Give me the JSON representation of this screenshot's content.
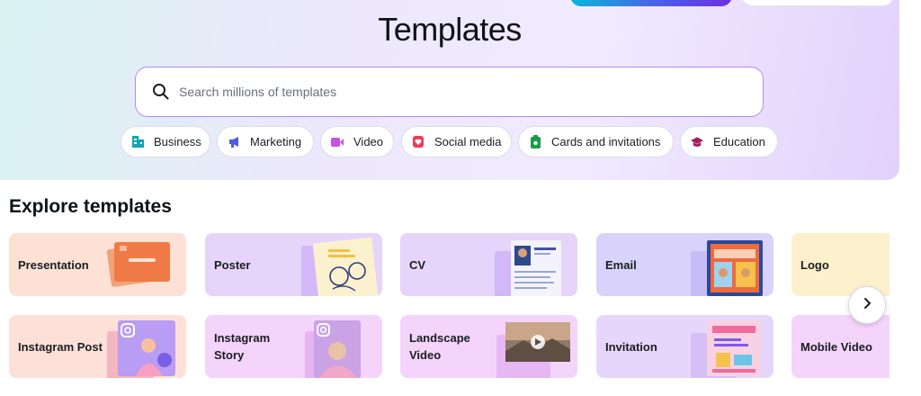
{
  "header": {
    "title": "Templates"
  },
  "search": {
    "placeholder": "Search millions of templates"
  },
  "chips": [
    {
      "label": "Business",
      "icon": "briefcase-icon",
      "color": "#13a3b4"
    },
    {
      "label": "Marketing",
      "icon": "megaphone-icon",
      "color": "#4a5ee8"
    },
    {
      "label": "Video",
      "icon": "video-camera-icon",
      "color": "#c94fe6"
    },
    {
      "label": "Social media",
      "icon": "heart-badge-icon",
      "color": "#ec3b54"
    },
    {
      "label": "Cards and invitations",
      "icon": "card-icon",
      "color": "#1b9a4a"
    },
    {
      "label": "Education",
      "icon": "graduation-cap-icon",
      "color": "#a51a5c"
    }
  ],
  "explore": {
    "title": "Explore templates",
    "row1": [
      {
        "label": "Presentation",
        "bg": "#fde1d4"
      },
      {
        "label": "Poster",
        "bg": "#e6d4fb"
      },
      {
        "label": "CV",
        "bg": "#e6d4fb"
      },
      {
        "label": "Email",
        "bg": "#d9d3fb"
      },
      {
        "label": "Logo",
        "bg": "#fdf0cd"
      }
    ],
    "row2": [
      {
        "label": "Instagram Post",
        "bg": "#fde1d9"
      },
      {
        "label": "Instagram Story",
        "bg": "#f4d4fb"
      },
      {
        "label": "Landscape Video",
        "bg": "#f4d4fb"
      },
      {
        "label": "Invitation",
        "bg": "#e7d6fb"
      },
      {
        "label": "Mobile Video",
        "bg": "#f4d4fb"
      }
    ]
  }
}
